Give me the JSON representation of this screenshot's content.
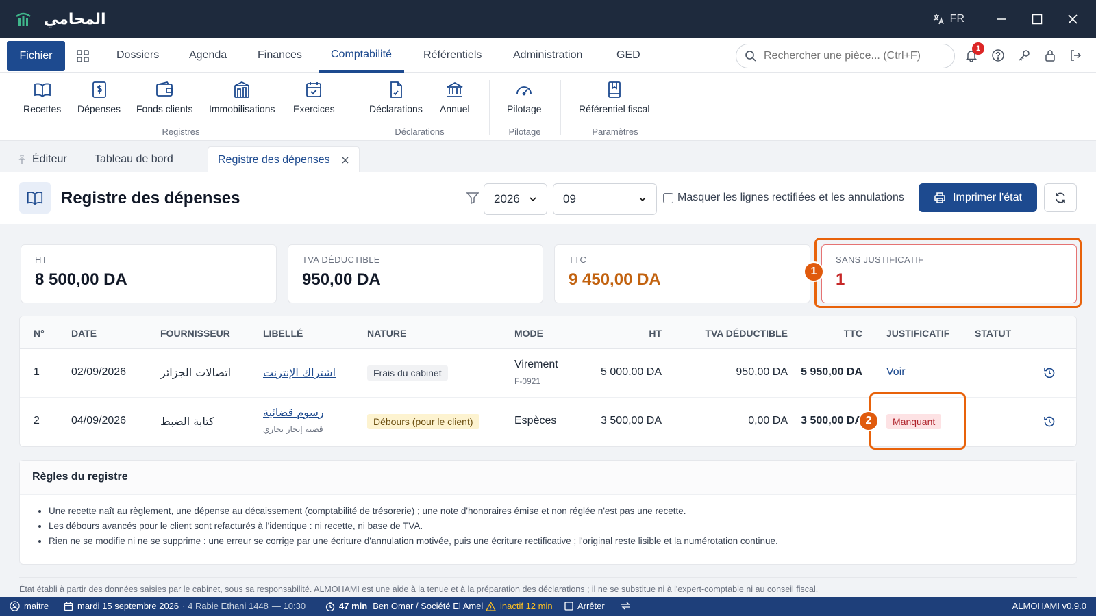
{
  "app": {
    "name": "المحامي",
    "lang": "FR"
  },
  "menu": {
    "fichier": "Fichier",
    "items": [
      "Dossiers",
      "Agenda",
      "Finances",
      "Comptabilité",
      "Référentiels",
      "Administration",
      "GED"
    ],
    "active": "Comptabilité",
    "search_placeholder": "Rechercher une pièce... (Ctrl+F)",
    "notif_count": "1"
  },
  "ribbon": {
    "buttons": [
      "Recettes",
      "Dépenses",
      "Fonds clients",
      "Immobilisations",
      "Exercices",
      "Déclarations",
      "Annuel",
      "Pilotage",
      "Référentiel fiscal"
    ],
    "groups": [
      "Registres",
      "Déclarations",
      "Pilotage",
      "Paramètres"
    ]
  },
  "tabs": {
    "editor": "Éditeur",
    "dashboard": "Tableau de bord",
    "active": "Registre des dépenses"
  },
  "page": {
    "title": "Registre des dépenses",
    "year": "2026",
    "month": "09",
    "hide_label": "Masquer les lignes rectifiées et les annulations",
    "print_label": "Imprimer l'état"
  },
  "kpis": [
    {
      "label": "HT",
      "value": "8 500,00 DA"
    },
    {
      "label": "TVA DÉDUCTIBLE",
      "value": "950,00 DA"
    },
    {
      "label": "TTC",
      "value": "9 450,00 DA"
    },
    {
      "label": "SANS JUSTIFICATIF",
      "value": "1"
    }
  ],
  "callouts": [
    "1",
    "2"
  ],
  "table": {
    "headers": [
      "N°",
      "DATE",
      "FOURNISSEUR",
      "LIBELLÉ",
      "NATURE",
      "MODE",
      "HT",
      "TVA DÉDUCTIBLE",
      "TTC",
      "JUSTIFICATIF",
      "STATUT"
    ],
    "rows": [
      {
        "num": "1",
        "date": "02/09/2026",
        "supplier": "اتصالات الجزائر",
        "label": "اشتراك الإنترنت",
        "label_sub": "",
        "nature": "Frais du cabinet",
        "mode": "Virement",
        "mode_sub": "F-0921",
        "ht": "5 000,00 DA",
        "tva": "950,00 DA",
        "ttc": "5 950,00 DA",
        "justif": "Voir"
      },
      {
        "num": "2",
        "date": "04/09/2026",
        "supplier": "كتابة الضبط",
        "label": "رسوم قضائية",
        "label_sub": "قضية إيجار تجاري",
        "nature": "Débours (pour le client)",
        "mode": "Espèces",
        "mode_sub": "",
        "ht": "3 500,00 DA",
        "tva": "0,00 DA",
        "ttc": "3 500,00 DA",
        "justif": "Manquant"
      }
    ]
  },
  "rules": {
    "title": "Règles du registre",
    "items": [
      "Une recette naît au règlement, une dépense au décaissement (comptabilité de trésorerie) ; une note d'honoraires émise et non réglée n'est pas une recette.",
      "Les débours avancés pour le client sont refacturés à l'identique : ni recette, ni base de TVA.",
      "Rien ne se modifie ni ne se supprime : une erreur se corrige par une écriture d'annulation motivée, puis une écriture rectificative ; l'original reste lisible et la numérotation continue."
    ]
  },
  "disclaimer": "État établi à partir des données saisies par le cabinet, sous sa responsabilité. ALMOHAMI est une aide à la tenue et à la préparation des déclarations ; il ne se substitue ni à l'expert-comptable ni au conseil fiscal.",
  "status": {
    "user": "maitre",
    "date": "mardi 15 septembre 2026",
    "hijri": "· 4 Rabie Ethani 1448",
    "time": "— 10:30",
    "timer": "47 min",
    "client": "Ben Omar / Société El Amel",
    "inactive": "inactif 12 min",
    "stop": "Arrêter",
    "version": "ALMOHAMI v0.9.0"
  },
  "colors": {
    "primary": "#1d4a8f",
    "titlebar": "#1e2a3d",
    "statusbar": "#1e3f7a",
    "highlight": "#e8620a",
    "ttc": "#c2620f",
    "missing": "#c62828"
  }
}
